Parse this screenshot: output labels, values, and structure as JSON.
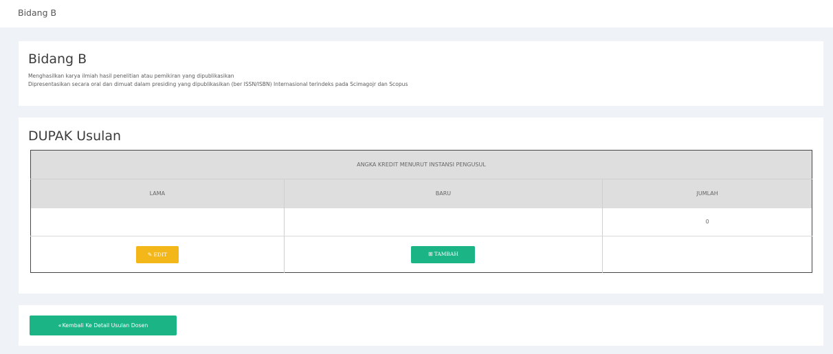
{
  "breadcrumb": "Bidang B",
  "info": {
    "title": "Bidang B",
    "line1": "Menghasilkan karya ilmiah hasil penelitian atau pemikiran yang dipublikasikan",
    "line2": "Dipresentasikan secara oral dan dimuat dalam presiding yang dipublikasikan (ber ISSN/ISBN) Internasional terindeks pada Scimagojr dan Scopus"
  },
  "dupak": {
    "title": "DUPAK Usulan",
    "group_header": "ANGKA KREDIT MENURUT INSTANSI PENGUSUL",
    "columns": [
      "LAMA",
      "BARU",
      "JUMLAH"
    ],
    "values": [
      "",
      "",
      "0"
    ],
    "edit_label": "EDIT",
    "add_label": "TAMBAH"
  },
  "footer": {
    "back_label": "Kembali Ke Detail Usulan Dosen"
  },
  "icons": {
    "edit": "pencil-square-icon",
    "add": "plus-square-icon",
    "back": "double-chevron-left-icon"
  },
  "colors": {
    "edit_button": "#f4b719",
    "primary_button": "#1bb585",
    "page_bg": "#eff2f7"
  }
}
